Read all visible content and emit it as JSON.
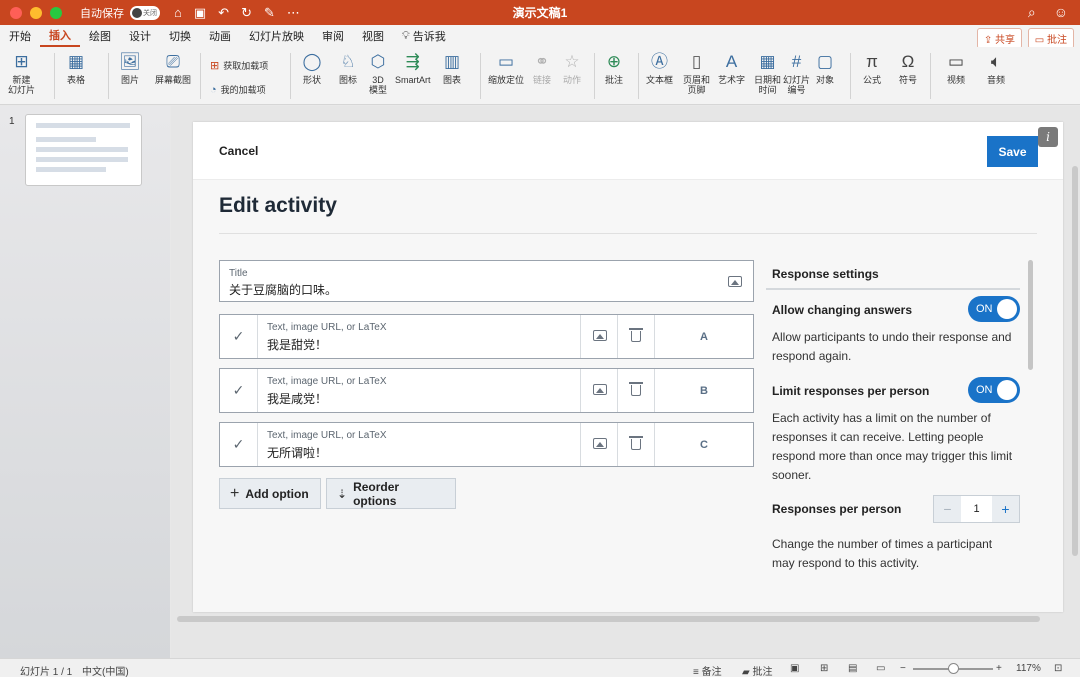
{
  "window": {
    "autosave_label": "自动保存",
    "autosave_state": "关闭",
    "title": "演示文稿1"
  },
  "ribbon_tabs": [
    "开始",
    "插入",
    "绘图",
    "设计",
    "切换",
    "动画",
    "幻灯片放映",
    "审阅",
    "视图",
    "告诉我"
  ],
  "active_tab": "插入",
  "share_label": "共享",
  "comment_label": "批注",
  "ribbon": {
    "new_slide": "新建\n幻灯片",
    "table": "表格",
    "picture": "图片",
    "screenshot": "屏幕截图",
    "get_addins": "获取加载项",
    "my_addins": "我的加载项",
    "shapes": "形状",
    "icons": "图标",
    "model3d": "3D\n模型",
    "smartart": "SmartArt",
    "chart": "图表",
    "zoom": "缩放定位",
    "link": "链接",
    "action": "动作",
    "comment": "批注",
    "textbox": "文本框",
    "header_footer": "页眉和\n页脚",
    "wordart": "艺术字",
    "datetime": "日期和\n时间",
    "slide_number": "幻灯片\n编号",
    "object": "对象",
    "equation": "公式",
    "symbol": "符号",
    "video": "视频",
    "audio": "音频"
  },
  "thumbnail_number": "1",
  "activity": {
    "cancel": "Cancel",
    "save": "Save",
    "info": "i",
    "heading": "Edit activity",
    "title_label": "Title",
    "title_value": "关于豆腐脑的口味。",
    "options": [
      {
        "placeholder": "Text, image URL, or LaTeX",
        "value": "我是甜党！",
        "letter": "A"
      },
      {
        "placeholder": "Text, image URL, or LaTeX",
        "value": "我是咸党！",
        "letter": "B"
      },
      {
        "placeholder": "Text, image URL, or LaTeX",
        "value": "无所谓啦！",
        "letter": "C"
      }
    ],
    "add_option": "Add option",
    "reorder_options": "Reorder options"
  },
  "settings": {
    "heading": "Response settings",
    "allow_changing": "Allow changing answers",
    "allow_changing_toggle": "ON",
    "allow_changing_desc": "Allow participants to undo their response and respond again.",
    "limit_responses": "Limit responses per person",
    "limit_responses_toggle": "ON",
    "limit_responses_desc": "Each activity has a limit on the number of responses it can receive. Letting people respond more than once may trigger this limit sooner.",
    "responses_per_person": "Responses per person",
    "responses_value": "1",
    "responses_desc": "Change the number of times a participant may respond to this activity."
  },
  "status": {
    "slide_count": "幻灯片 1 / 1",
    "language": "中文(中国)",
    "notes": "备注",
    "comments": "批注",
    "zoom": "117%"
  }
}
